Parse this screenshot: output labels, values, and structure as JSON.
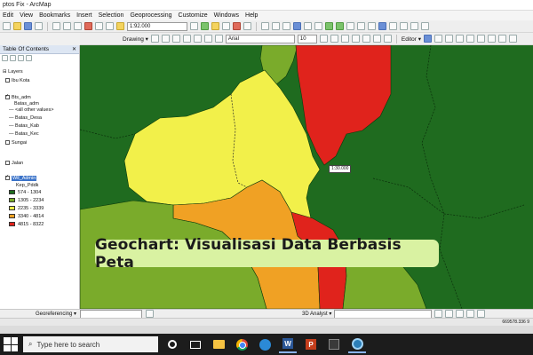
{
  "window": {
    "title": "ptos Fix - ArcMap"
  },
  "menu": [
    "Edit",
    "View",
    "Bookmarks",
    "Insert",
    "Selection",
    "Geoprocessing",
    "Customize",
    "Windows",
    "Help"
  ],
  "toolbar": {
    "scale_value": "1:92.000",
    "drawing_label": "Drawing ▾",
    "font_name": "Arial",
    "font_size": "10",
    "editor_label": "Editor ▾"
  },
  "toc": {
    "title": "Table Of Contents",
    "layers_label": "Layers",
    "items": [
      {
        "label": "Ibu Kota",
        "checked": false
      },
      {
        "label": "Bts_adm",
        "checked": true
      },
      {
        "label": "Batas_adm"
      },
      {
        "label": "<all other values>"
      },
      {
        "label": "Batas_Desa"
      },
      {
        "label": "Batas_Kab"
      },
      {
        "label": "Batas_Kec"
      },
      {
        "label": "Sungai",
        "checked": false
      },
      {
        "label": "Jalan",
        "checked": false
      },
      {
        "label": "Wil_Admin",
        "checked": true
      },
      {
        "label": "Kep_Pddk"
      }
    ],
    "legend": [
      {
        "label": "574 - 1304",
        "color": "#1e6b1e"
      },
      {
        "label": "1305 - 2234",
        "color": "#7aab2b"
      },
      {
        "label": "2235 - 3339",
        "color": "#f2f04a"
      },
      {
        "label": "3340 - 4814",
        "color": "#f0a124"
      },
      {
        "label": "4815 - 8322",
        "color": "#e0231c"
      }
    ]
  },
  "map": {
    "scale_label": "1:30.000",
    "banner_text": "Geochart: Visualisasi Data Berbasis Peta"
  },
  "bottom": {
    "georef_label": "Georeferencing ▾",
    "analyst_label": "3D Analyst ▾",
    "coords": "669578.336 9"
  },
  "taskbar": {
    "search_placeholder": "Type here to search"
  }
}
